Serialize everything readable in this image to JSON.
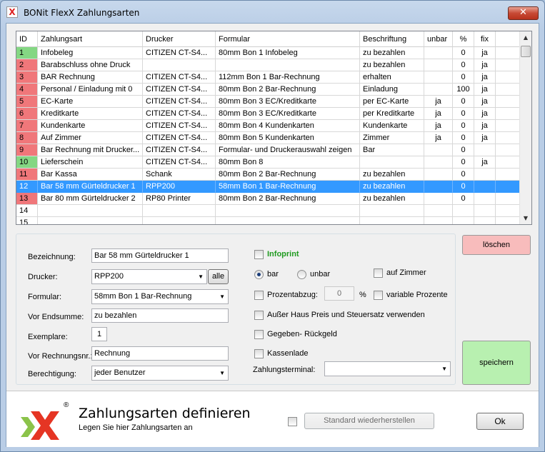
{
  "window": {
    "title": "BONit FlexX Zahlungsarten",
    "close_glyph": "✕",
    "app_icon": "X"
  },
  "grid": {
    "columns": [
      "ID",
      "Zahlungsart",
      "Drucker",
      "Formular",
      "Beschriftung",
      "unbar",
      "%",
      "fix"
    ],
    "rows": [
      {
        "id": "1",
        "id_color": "green",
        "name": "Infobeleg",
        "drucker": "CITIZEN CT-S4...",
        "formular": "80mm Bon 1  Infobeleg",
        "beschriftung": "zu bezahlen",
        "unbar": "",
        "pct": "0",
        "fix": "ja"
      },
      {
        "id": "2",
        "id_color": "red",
        "name": "Barabschluss ohne Druck",
        "drucker": "",
        "formular": "",
        "beschriftung": "zu bezahlen",
        "unbar": "",
        "pct": "0",
        "fix": "ja"
      },
      {
        "id": "3",
        "id_color": "red",
        "name": "BAR Rechnung",
        "drucker": "CITIZEN CT-S4...",
        "formular": "112mm Bon 1  Bar-Rechnung",
        "beschriftung": "erhalten",
        "unbar": "",
        "pct": "0",
        "fix": "ja"
      },
      {
        "id": "4",
        "id_color": "red",
        "name": "Personal / Einladung mit 0",
        "drucker": "CITIZEN CT-S4...",
        "formular": "80mm Bon 2  Bar-Rechnung",
        "beschriftung": "Einladung",
        "unbar": "",
        "pct": "100",
        "fix": "ja"
      },
      {
        "id": "5",
        "id_color": "red",
        "name": "EC-Karte",
        "drucker": "CITIZEN CT-S4...",
        "formular": "80mm Bon 3  EC/Kreditkarte",
        "beschriftung": "per EC-Karte",
        "unbar": "ja",
        "pct": "0",
        "fix": "ja"
      },
      {
        "id": "6",
        "id_color": "red",
        "name": "Kreditkarte",
        "drucker": "CITIZEN CT-S4...",
        "formular": "80mm Bon 3  EC/Kreditkarte",
        "beschriftung": "per Kreditkarte",
        "unbar": "ja",
        "pct": "0",
        "fix": "ja"
      },
      {
        "id": "7",
        "id_color": "red",
        "name": "Kundenkarte",
        "drucker": "CITIZEN CT-S4...",
        "formular": "80mm Bon 4  Kundenkarten",
        "beschriftung": "Kundenkarte",
        "unbar": "ja",
        "pct": "0",
        "fix": "ja"
      },
      {
        "id": "8",
        "id_color": "red",
        "name": "Auf Zimmer",
        "drucker": "CITIZEN CT-S4...",
        "formular": "80mm Bon 5  Kundenkarten",
        "beschriftung": "Zimmer",
        "unbar": "ja",
        "pct": "0",
        "fix": "ja"
      },
      {
        "id": "9",
        "id_color": "red",
        "name": "Bar Rechnung mit Drucker...",
        "drucker": "CITIZEN CT-S4...",
        "formular": "Formular- und Druckerauswahl zeigen",
        "beschriftung": "Bar",
        "unbar": "",
        "pct": "0",
        "fix": ""
      },
      {
        "id": "10",
        "id_color": "green",
        "name": "Lieferschein",
        "drucker": "CITIZEN CT-S4...",
        "formular": "80mm Bon 8",
        "beschriftung": "",
        "unbar": "",
        "pct": "0",
        "fix": "ja"
      },
      {
        "id": "11",
        "id_color": "red",
        "name": "Bar Kassa",
        "drucker": "Schank",
        "formular": "80mm Bon 2  Bar-Rechnung",
        "beschriftung": "zu bezahlen",
        "unbar": "",
        "pct": "0",
        "fix": ""
      },
      {
        "id": "12",
        "id_color": "selected",
        "name": "Bar 58 mm Gürteldrucker 1",
        "drucker": "RPP200",
        "formular": "58mm Bon 1  Bar-Rechnung",
        "beschriftung": "zu bezahlen",
        "unbar": "",
        "pct": "0",
        "fix": ""
      },
      {
        "id": "13",
        "id_color": "red",
        "name": "Bar 80 mm Gürteldrucker 2",
        "drucker": "RP80 Printer",
        "formular": "80mm Bon 2  Bar-Rechnung",
        "beschriftung": "zu bezahlen",
        "unbar": "",
        "pct": "0",
        "fix": ""
      },
      {
        "id": "14",
        "id_color": "none",
        "name": "",
        "drucker": "",
        "formular": "",
        "beschriftung": "",
        "unbar": "",
        "pct": "",
        "fix": ""
      },
      {
        "id": "15",
        "id_color": "none",
        "name": "",
        "drucker": "",
        "formular": "",
        "beschriftung": "",
        "unbar": "",
        "pct": "",
        "fix": ""
      }
    ],
    "selected_row_index": 11
  },
  "form": {
    "bezeichnung_label": "Bezeichnung:",
    "bezeichnung_value": "Bar 58 mm Gürteldrucker 1",
    "drucker_label": "Drucker:",
    "drucker_value": "RPP200",
    "alle_button": "alle",
    "formular_label": "Formular:",
    "formular_value": "58mm Bon 1   Bar-Rechnung",
    "endsumme_label": "Vor Endsumme:",
    "endsumme_value": "zu bezahlen",
    "exemplare_label": "Exemplare:",
    "exemplare_value": "1",
    "rechnungsnr_label": "Vor Rechnungsnr.:",
    "rechnungsnr_value": "Rechnung",
    "berechtigung_label": "Berechtigung:",
    "berechtigung_value": "jeder Benutzer",
    "infoprint_label": "Infoprint",
    "bar_label": "bar",
    "unbar_label": "unbar",
    "aufzimmer_label": "auf Zimmer",
    "prozentabzug_label": "Prozentabzug:",
    "prozentabzug_value": "0",
    "percent_sign": "%",
    "variable_prozente_label": "variable Prozente",
    "ausser_haus_label": "Außer Haus Preis und Steuersatz verwenden",
    "gegeben_label": "Gegeben- Rückgeld",
    "kassenlade_label": "Kassenlade",
    "zahlungsterminal_label": "Zahlungsterminal:",
    "zahlungsterminal_value": ""
  },
  "buttons": {
    "loeschen": "löschen",
    "speichern": "speichern",
    "standard": "Standard wiederherstellen",
    "ok": "Ok"
  },
  "footer": {
    "title": "Zahlungsarten definieren",
    "subtitle": "Legen Sie hier Zahlungsarten an",
    "logo_mark": "®"
  },
  "colors": {
    "id_green": "#84d783",
    "id_red": "#f0777a",
    "selection": "#3399ff",
    "loeschen_bg": "#f8bcbc",
    "speichern_bg": "#b8f0b0",
    "infoprint": "#1f9a1f"
  }
}
